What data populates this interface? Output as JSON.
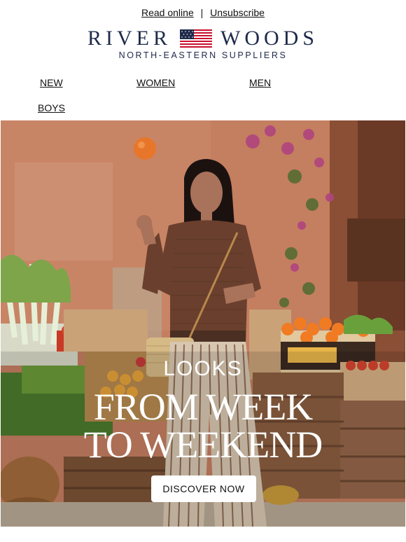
{
  "header": {
    "read_online": "Read online",
    "separator": "|",
    "unsubscribe": "Unsubscribe"
  },
  "brand": {
    "name_left": "RIVER",
    "name_right": "WOODS",
    "tagline": "NORTH-EASTERN SUPPLIERS",
    "color": "#1e2a4a"
  },
  "nav": {
    "items": [
      "NEW",
      "WOMEN",
      "MEN",
      "BOYS"
    ]
  },
  "hero": {
    "kicker": "LOOKS",
    "headline_line1": "FROM WEEK",
    "headline_line2": "TO WEEKEND",
    "cta_label": "DISCOVER NOW"
  }
}
